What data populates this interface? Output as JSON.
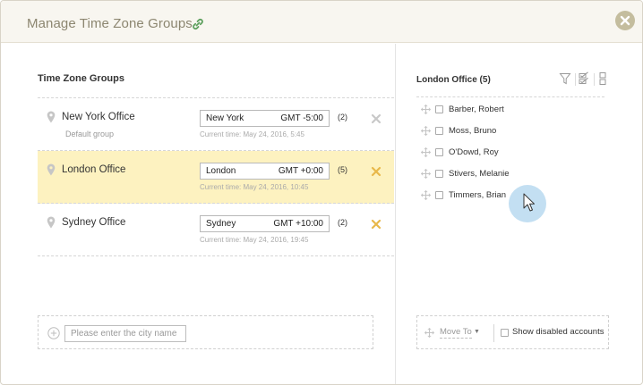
{
  "dialog": {
    "title": "Manage Time Zone Groups",
    "icons": {
      "title": "link-icon",
      "close": "close-icon"
    }
  },
  "groups": {
    "title": "Time Zone Groups",
    "items": [
      {
        "name": "New York Office",
        "sub": "Default group",
        "city": "New York",
        "offset": "GMT -5:00",
        "time": "Current time: May 24, 2016, 5:45",
        "count": "(2)",
        "selected": false
      },
      {
        "name": "London Office",
        "sub": "",
        "city": "London",
        "offset": "GMT +0:00",
        "time": "Current time: May 24, 2016, 10:45",
        "count": "(5)",
        "selected": true
      },
      {
        "name": "Sydney Office",
        "sub": "",
        "city": "Sydney",
        "offset": "GMT +10:00",
        "time": "Current time: May 24, 2016, 19:45",
        "count": "(2)",
        "selected": false
      }
    ],
    "add_city": {
      "placeholder": "Please enter the city name"
    }
  },
  "members": {
    "title": "London Office (5)",
    "tools": [
      "filter-icon",
      "check-all-icon",
      "columns-icon"
    ],
    "items": [
      "Barber, Robert",
      "Moss, Bruno",
      "O'Dowd, Roy",
      "Stivers, Melanie",
      "Timmers, Brian"
    ],
    "move_to": "Move To",
    "show_disabled": "Show disabled accounts"
  },
  "colors": {
    "header_bg": "#f8f6f0",
    "title": "#8c8670",
    "selected_row": "#fdf2c0",
    "remove_active": "#e8b84a",
    "remove_inactive": "#c8c8c8",
    "close_button": "#c4bd9e",
    "link_icon": "#5ea05e"
  }
}
